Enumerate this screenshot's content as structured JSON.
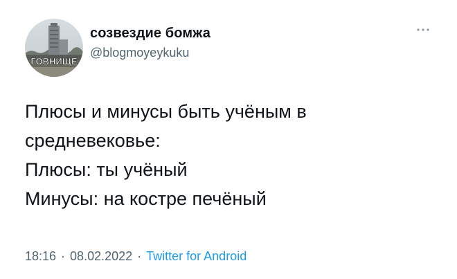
{
  "tweet": {
    "avatar": {
      "icon": "avatar-building-photo-icon",
      "caption": "ГОВНИЩЕ"
    },
    "display_name": "созвездие бомжа",
    "handle": "@blogmoyeykuku",
    "more_icon": "more-dots-icon",
    "body_lines": [
      "Плюсы и минусы быть учёным в",
      "средневековье:",
      "Плюсы: ты учёный",
      "Минусы: на костре печёный"
    ],
    "time": "18:16",
    "date": "08.02.2022",
    "separator": "·",
    "source": "Twitter for Android"
  },
  "colors": {
    "text_primary": "#0f1419",
    "text_secondary": "#536471",
    "link": "#1d9bf0",
    "background": "#ffffff"
  }
}
